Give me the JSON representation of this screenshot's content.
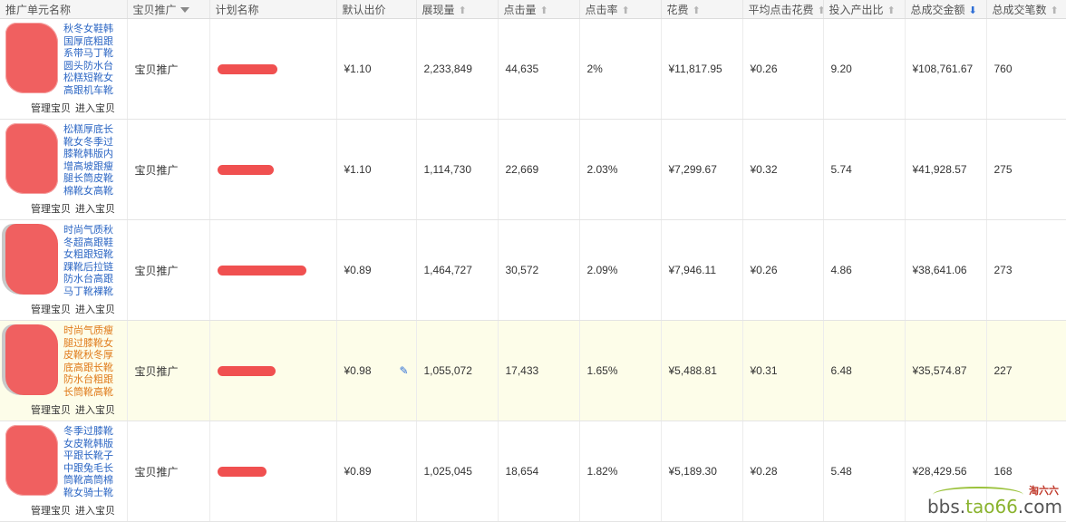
{
  "header": {
    "unit_name": "推广单元名称",
    "promo_type": "宝贝推广",
    "plan_name": "计划名称",
    "default_bid": "默认出价",
    "impressions": "展现量",
    "clicks": "点击量",
    "ctr": "点击率",
    "cost": "花费",
    "avg_cpc": "平均点击花费",
    "roi": "投入产出比",
    "gmv": "总成交金额",
    "orders": "总成交笔数",
    "sort_up_icon": "arrow-up-icon",
    "sort_down_icon": "arrow-down-icon"
  },
  "row_links": {
    "manage": "管理宝贝",
    "enter": "进入宝贝"
  },
  "rows": [
    {
      "title": "秋冬女鞋韩国厚底粗跟系带马丁靴圆头防水台松糕短靴女高跟机车靴",
      "type": "宝贝推广",
      "bid": "¥1.10",
      "impressions": "2,233,849",
      "clicks": "44,635",
      "ctr": "2%",
      "cost": "¥11,817.95",
      "cpc": "¥0.26",
      "roi": "9.20",
      "gmv": "¥108,761.67",
      "orders": "760"
    },
    {
      "title": "松糕厚底长靴女冬季过膝靴韩版内增高坡跟瘦腿长筒皮靴棉靴女高靴",
      "type": "宝贝推广",
      "bid": "¥1.10",
      "impressions": "1,114,730",
      "clicks": "22,669",
      "ctr": "2.03%",
      "cost": "¥7,299.67",
      "cpc": "¥0.32",
      "roi": "5.74",
      "gmv": "¥41,928.57",
      "orders": "275"
    },
    {
      "title": "时尚气质秋冬超高跟鞋女粗跟短靴踝靴后拉链防水台高跟马丁靴裸靴",
      "type": "宝贝推广",
      "bid": "¥0.89",
      "impressions": "1,464,727",
      "clicks": "30,572",
      "ctr": "2.09%",
      "cost": "¥7,946.11",
      "cpc": "¥0.26",
      "roi": "4.86",
      "gmv": "¥38,641.06",
      "orders": "273"
    },
    {
      "title": "时尚气质瘦腿过膝靴女皮靴秋冬厚底高跟长靴防水台粗跟长筒靴高靴",
      "type": "宝贝推广",
      "bid": "¥0.98",
      "impressions": "1,055,072",
      "clicks": "17,433",
      "ctr": "1.65%",
      "cost": "¥5,488.81",
      "cpc": "¥0.31",
      "roi": "6.48",
      "gmv": "¥35,574.87",
      "orders": "227"
    },
    {
      "title": "冬季过膝靴女皮靴韩版平跟长靴子中跟兔毛长筒靴高筒棉靴女骑士靴",
      "type": "宝贝推广",
      "bid": "¥0.89",
      "impressions": "1,025,045",
      "clicks": "18,654",
      "ctr": "1.82%",
      "cost": "¥5,189.30",
      "cpc": "¥0.28",
      "roi": "5.48",
      "gmv": "¥28,429.56",
      "orders": "168"
    }
  ],
  "watermark": {
    "site_a": "bbs.",
    "site_b": "tao66",
    "site_c": ".com",
    "cn": "淘六六"
  },
  "colors": {
    "link": "#2d67c4",
    "highlight_title": "#e07b1b",
    "highlight_row": "#fdfde9",
    "sort_active": "#2f6fd6",
    "redaction": "#f05050"
  }
}
